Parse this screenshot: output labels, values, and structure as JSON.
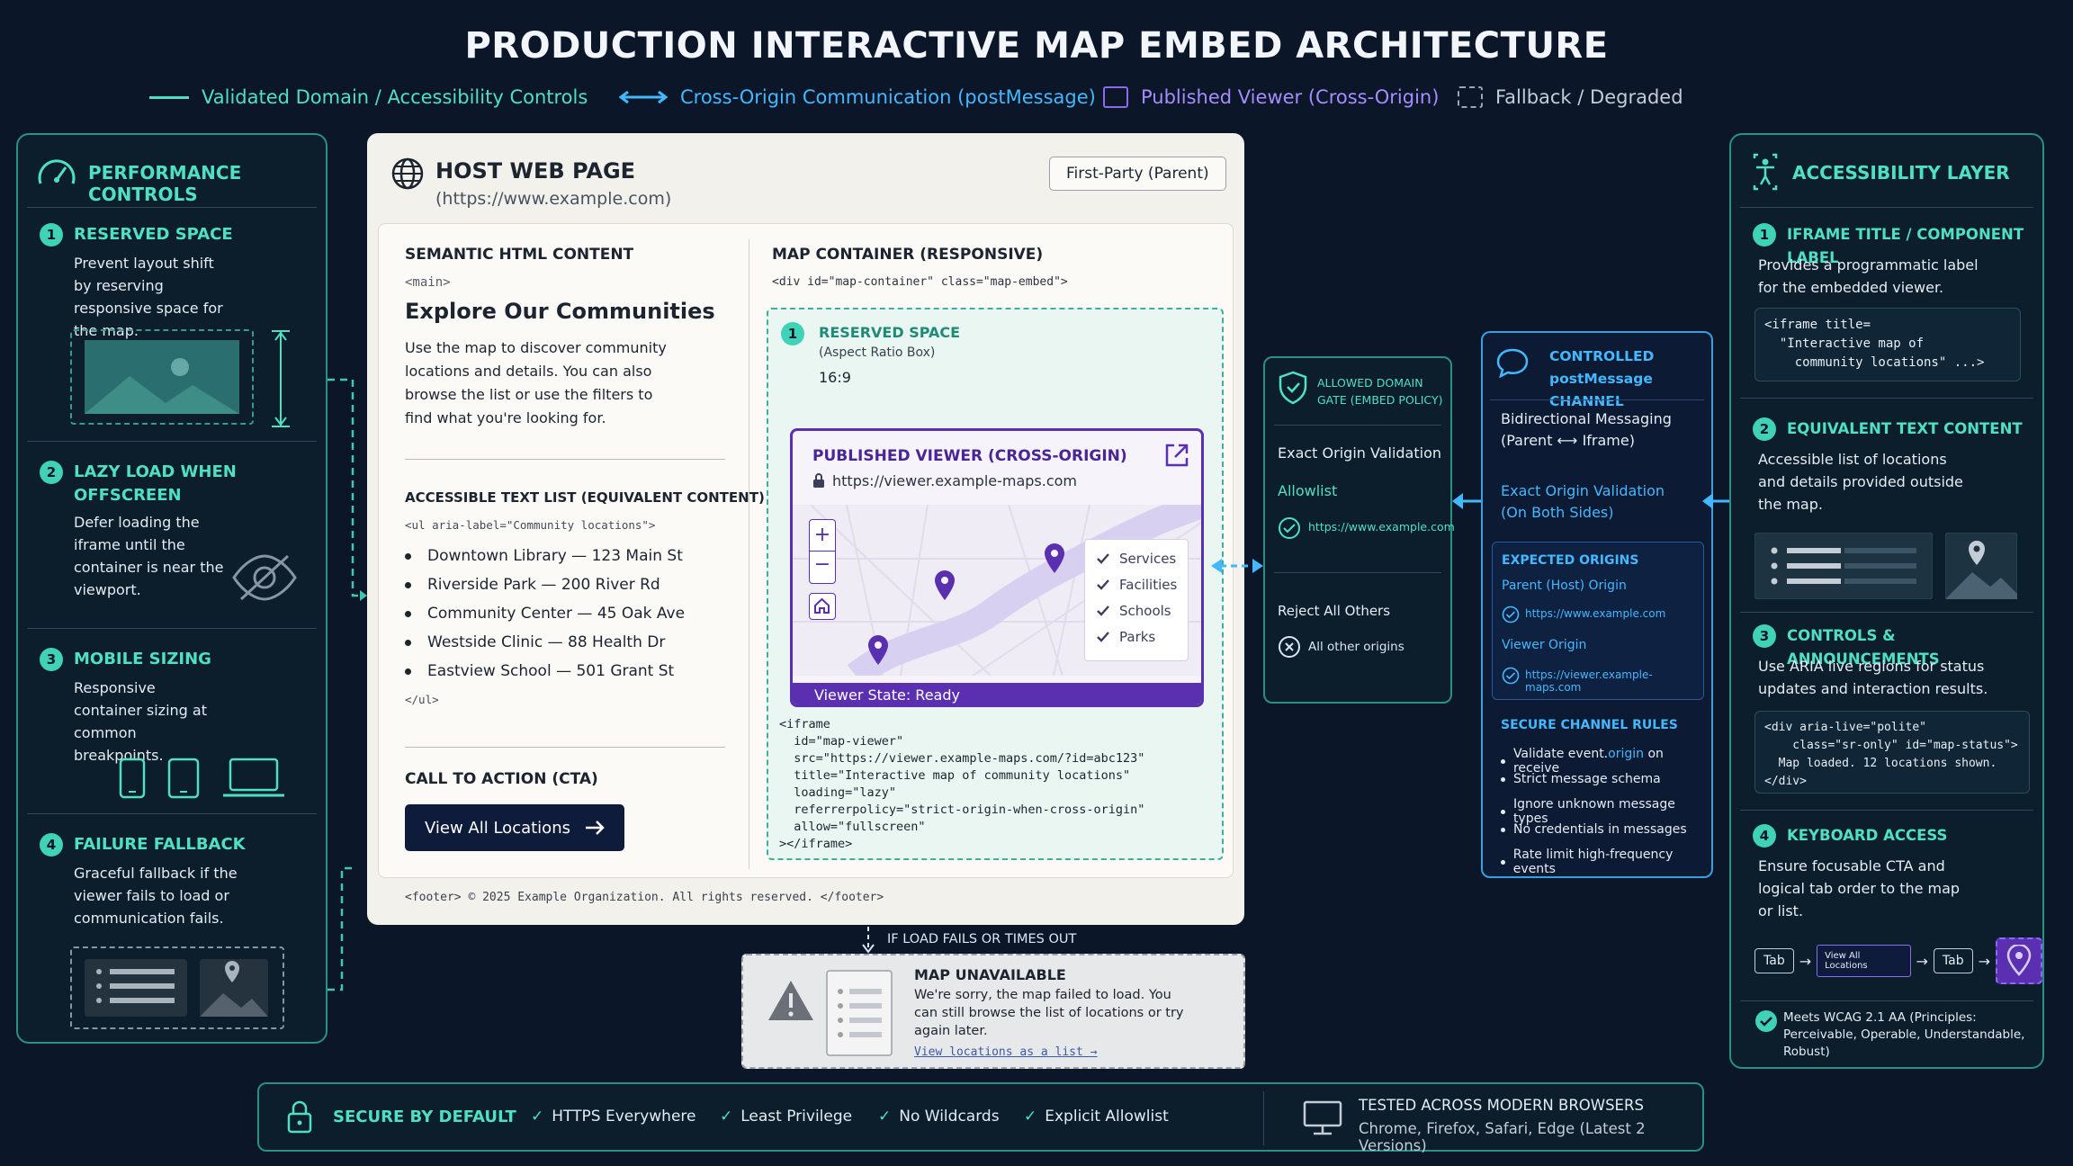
{
  "title": "PRODUCTION INTERACTIVE MAP EMBED ARCHITECTURE",
  "legend": {
    "validated": "Validated Domain / Accessibility Controls",
    "cross_origin": "Cross-Origin Communication (postMessage)",
    "published": "Published Viewer (Cross-Origin)",
    "fallback": "Fallback / Degraded"
  },
  "colors": {
    "teal": "#4fe0c4",
    "blue": "#44b8ff",
    "purple": "#5a2fb0",
    "navy": "#0f1b3a",
    "background": "#0b1628"
  },
  "performance": {
    "title": "PERFORMANCE CONTROLS",
    "items": [
      {
        "num": "1",
        "title": "RESERVED SPACE",
        "text": "Prevent layout shift by reserving responsive space for the map."
      },
      {
        "num": "2",
        "title": "LAZY LOAD WHEN OFFSCREEN",
        "text": "Defer loading the iframe until the container is near the viewport."
      },
      {
        "num": "3",
        "title": "MOBILE SIZING",
        "text": "Responsive container sizing at common breakpoints."
      },
      {
        "num": "4",
        "title": "FAILURE FALLBACK",
        "text": "Graceful fallback if the viewer fails to load or communication fails."
      }
    ]
  },
  "host": {
    "title": "HOST WEB PAGE",
    "url": "(https://www.example.com)",
    "badge": "First-Party (Parent)",
    "semantic": {
      "label": "SEMANTIC HTML CONTENT",
      "tag": "<main>",
      "heading": "Explore Our Communities",
      "body": "Use the map to discover community locations and details. You can also browse the list or use the filters to find what you're looking for."
    },
    "list": {
      "label": "ACCESSIBLE TEXT LIST (EQUIVALENT CONTENT)",
      "open_tag": "<ul aria-label=\"Community locations\">",
      "items": [
        "Downtown Library — 123 Main St",
        "Riverside Park — 200 River Rd",
        "Community Center — 45 Oak Ave",
        "Westside Clinic — 88 Health Dr",
        "Eastview School — 501 Grant St"
      ],
      "close_tag": "</ul>"
    },
    "cta": {
      "label": "CALL TO ACTION (CTA)",
      "button": "View All Locations"
    },
    "footer": "<footer>  © 2025 Example Organization. All rights reserved. </footer>",
    "map": {
      "label": "MAP CONTAINER (RESPONSIVE)",
      "tag": "<div id=\"map-container\" class=\"map-embed\">",
      "reserved_num": "1",
      "reserved_title": "RESERVED SPACE",
      "reserved_sub": "(Aspect Ratio Box)",
      "ratio": "16:9",
      "viewer_title": "PUBLISHED VIEWER (CROSS-ORIGIN)",
      "viewer_url": "https://viewer.example-maps.com",
      "filters": [
        "Services",
        "Facilities",
        "Schools",
        "Parks"
      ],
      "state": "Viewer State: Ready",
      "iframe_code": "<iframe\n  id=\"map-viewer\"\n  src=\"https://viewer.example-maps.com/?id=abc123\"\n  title=\"Interactive map of community locations\"\n  loading=\"lazy\"\n  referrerpolicy=\"strict-origin-when-cross-origin\"\n  allow=\"fullscreen\"\n></iframe>"
    }
  },
  "gate": {
    "title": "ALLOWED DOMAIN GATE (EMBED POLICY)",
    "exact": "Exact Origin Validation",
    "allowlist": "Allowlist",
    "allow_origin": "https://www.example.com",
    "reject": "Reject All Others",
    "reject_note": "All other origins"
  },
  "channel": {
    "title": "CONTROLLED postMessage CHANNEL",
    "bidir": "Bidirectional Messaging",
    "bidir_sub": "(Parent ⟷ Iframe)",
    "exact": "Exact Origin Validation (On Both Sides)",
    "expected": "EXPECTED ORIGINS",
    "parent_label": "Parent (Host) Origin",
    "parent_origin": "https://www.example.com",
    "viewer_label": "Viewer Origin",
    "viewer_origin": "https://viewer.example-maps.com",
    "rules_title": "SECURE CHANNEL RULES",
    "rule1_a": "Validate event.",
    "rule1_b": "origin",
    "rule1_c": " on receive",
    "rules": [
      "Strict message schema",
      "Ignore unknown message types",
      "No credentials in messages",
      "Rate limit high-frequency events"
    ]
  },
  "fallback": {
    "arrow_label": "IF LOAD FAILS OR TIMES OUT",
    "title": "MAP UNAVAILABLE",
    "text": "We're sorry, the map failed to load. You can still browse the list of locations or try again later.",
    "link": "View locations as a list →"
  },
  "accessibility": {
    "title": "ACCESSIBILITY LAYER",
    "items": [
      {
        "num": "1",
        "title": "IFRAME TITLE / COMPONENT LABEL",
        "text": "Provides a programmatic label for the embedded viewer."
      },
      {
        "num": "2",
        "title": "EQUIVALENT TEXT CONTENT",
        "text": "Accessible list of locations and details provided outside the map."
      },
      {
        "num": "3",
        "title": "CONTROLS & ANNOUNCEMENTS",
        "text": "Use ARIA live regions for status updates and interaction results."
      },
      {
        "num": "4",
        "title": "KEYBOARD ACCESS",
        "text": "Ensure focusable CTA and logical tab order to the map or list."
      }
    ],
    "code1": "<iframe title=\n  \"Interactive map of\n    community locations\" ...>",
    "code2": "<div aria-live=\"polite\"\n    class=\"sr-only\" id=\"map-status\">\n  Map loaded. 12 locations shown.\n</div>",
    "tab": "Tab",
    "tab_cta": "View All Locations",
    "wcag": "Meets WCAG 2.1 AA (Principles: Perceivable, Operable, Understandable, Robust)"
  },
  "bottom": {
    "secure": "SECURE BY DEFAULT",
    "checks": [
      "HTTPS Everywhere",
      "Least Privilege",
      "No Wildcards",
      "Explicit Allowlist"
    ],
    "tested_title": "TESTED ACROSS MODERN BROWSERS",
    "tested_sub": "Chrome, Firefox, Safari, Edge (Latest 2 Versions)"
  }
}
